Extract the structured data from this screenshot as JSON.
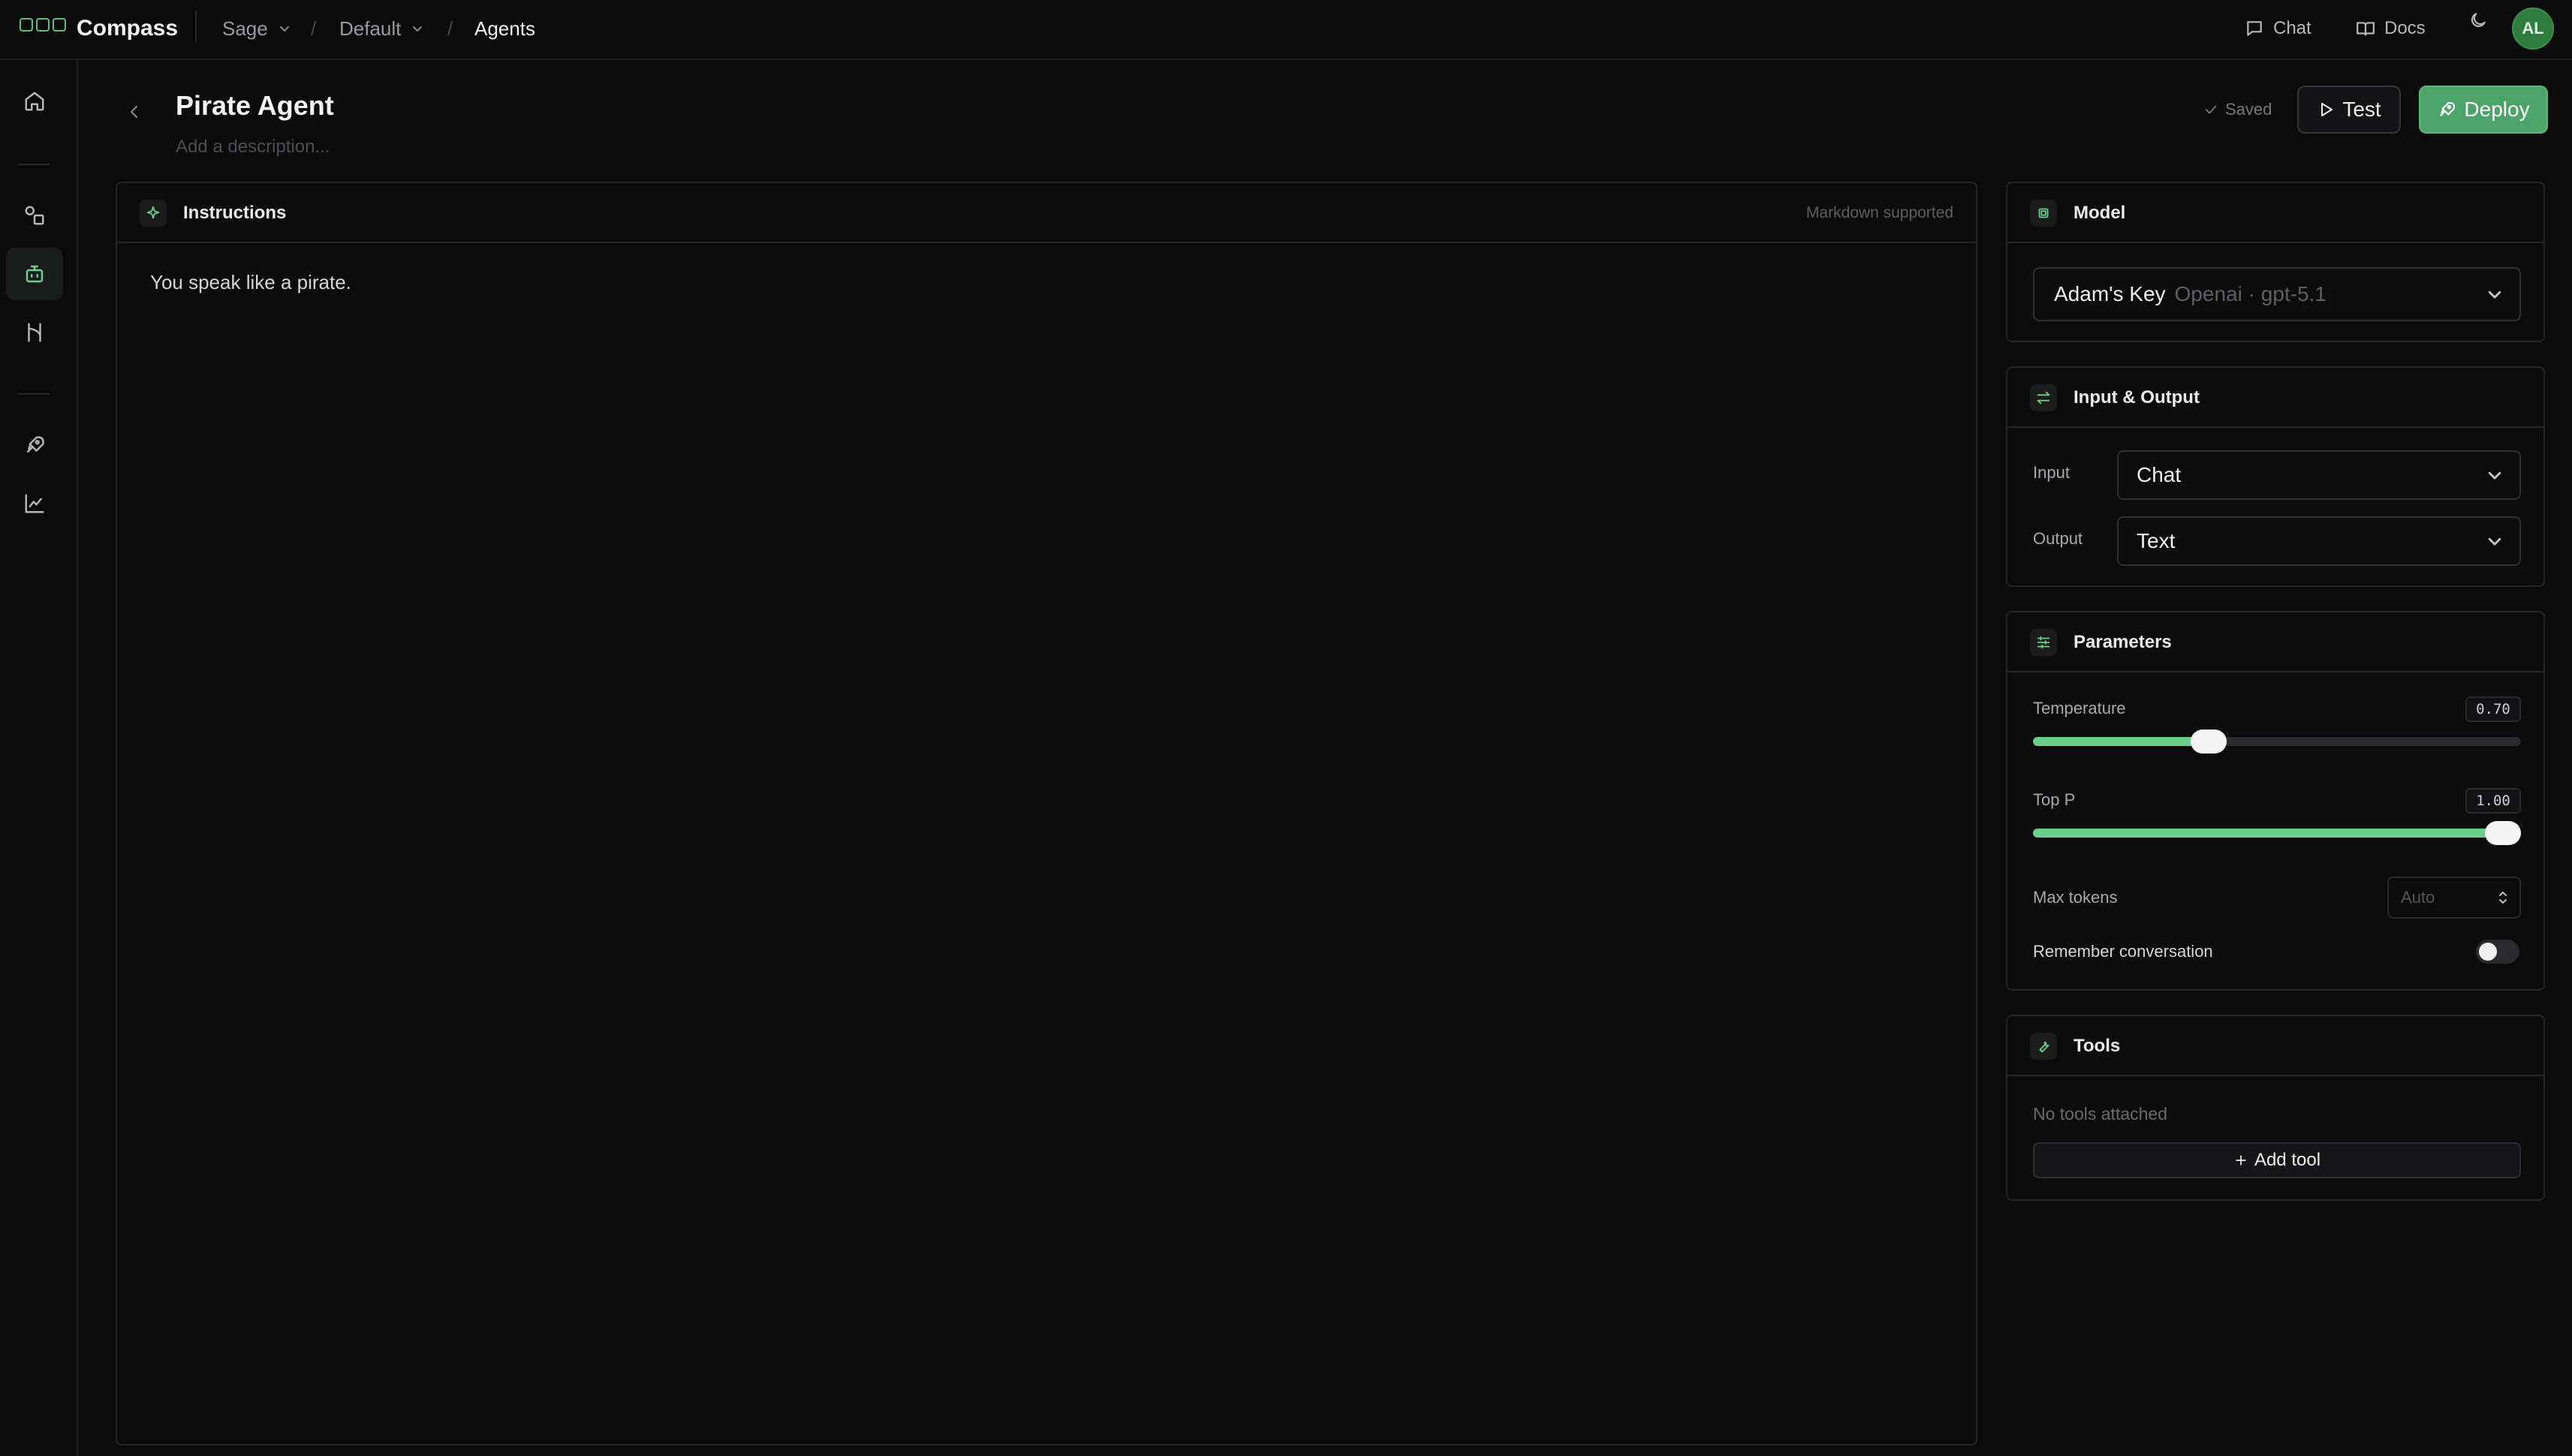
{
  "topbar": {
    "brand": "Compass",
    "breadcrumbs": [
      "Sage",
      "Default",
      "Agents"
    ],
    "chat_label": "Chat",
    "docs_label": "Docs",
    "avatar_initials": "AL"
  },
  "header": {
    "title": "Pirate Agent",
    "description_placeholder": "Add a description...",
    "saved_label": "Saved",
    "test_label": "Test",
    "deploy_label": "Deploy"
  },
  "instructions": {
    "title": "Instructions",
    "note": "Markdown supported",
    "text": "You speak like a pirate."
  },
  "model": {
    "title": "Model",
    "key_name": "Adam's Key",
    "provider_model": "Openai · gpt-5.1"
  },
  "io": {
    "title": "Input & Output",
    "input_label": "Input",
    "input_value": "Chat",
    "output_label": "Output",
    "output_value": "Text"
  },
  "parameters": {
    "title": "Parameters",
    "temperature_label": "Temperature",
    "temperature_value": "0.70",
    "temperature_fraction": 0.36,
    "top_p_label": "Top P",
    "top_p_value": "1.00",
    "top_p_fraction": 1.0,
    "max_tokens_label": "Max tokens",
    "max_tokens_placeholder": "Auto",
    "remember_label": "Remember conversation",
    "remember_on": false
  },
  "tools": {
    "title": "Tools",
    "empty_text": "No tools attached",
    "add_label": "Add tool"
  },
  "colors": {
    "accent": "#6bcf8c",
    "deploy_bg": "#4da46a",
    "background": "#0b0b0c"
  }
}
